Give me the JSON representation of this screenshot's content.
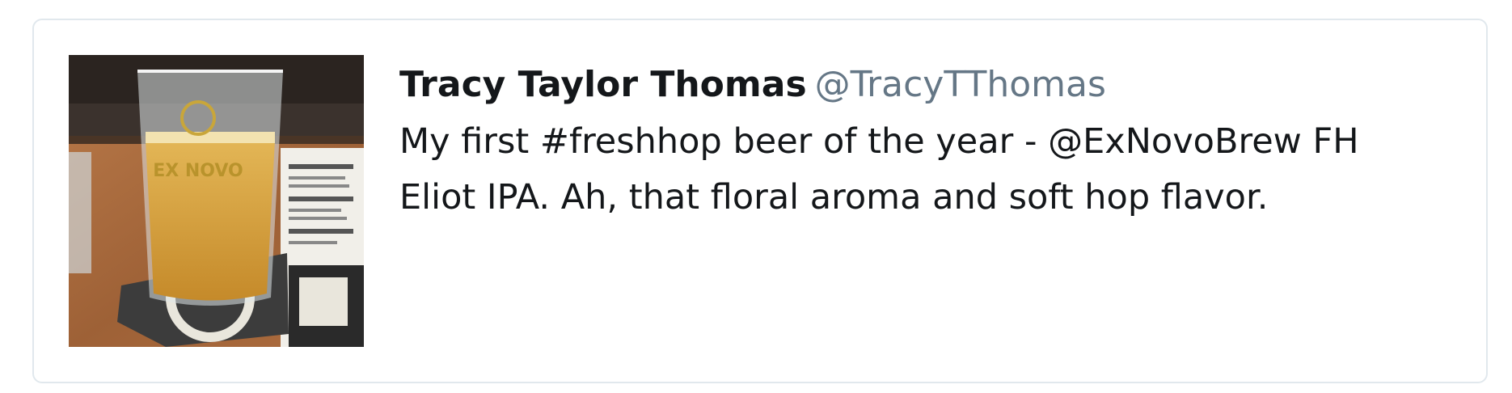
{
  "tweet": {
    "author_name": "Tracy Taylor Thomas",
    "author_handle": "@TracyTThomas",
    "text_line1": "My first #freshhop beer of the year - @ExNovoBrew FH",
    "text_line2": "Eliot IPA. Ah, that floral aroma and soft hop flavor.",
    "image_label": "EX NOVO"
  },
  "colors": {
    "name": "#14171a",
    "handle": "#657786",
    "border": "#e1e8ed",
    "beer": "#d9a43a"
  }
}
